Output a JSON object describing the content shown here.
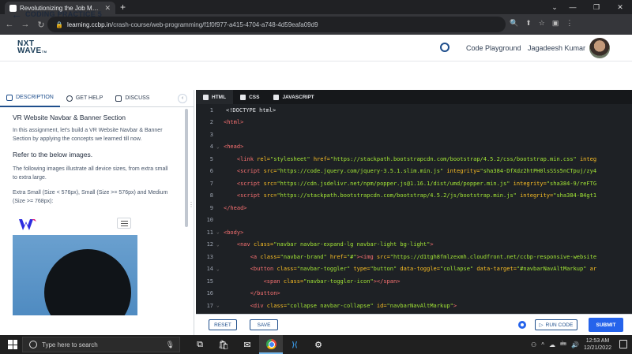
{
  "browser": {
    "tab_title": "Revolutionizing the Job Market |",
    "tab_close": "✕",
    "new_tab": "+",
    "url_host": "learning.ccbp.in",
    "url_path": "/crash-course/web-programming/f1f0f977-a415-4704-a748-4d59eafa09d9",
    "back": "←",
    "forward": "→",
    "reload": "↻",
    "lock": "🔒",
    "controls": [
      "⌄",
      "—",
      "❐",
      "✕"
    ],
    "addr_icons": [
      "🔍",
      "⬆",
      "☆",
      "▣",
      "⋮"
    ]
  },
  "header": {
    "logo_line1": "NXT",
    "logo_line2": "WAVE",
    "logo_tm": "TM",
    "code_playground": "Code Playground",
    "user_name": "Jagadeesh Kumar"
  },
  "subheader": {
    "back_icon": "←",
    "title": "CODING PRACTICE 5"
  },
  "left_panel": {
    "tabs": [
      {
        "label": "DESCRIPTION"
      },
      {
        "label": "GET HELP"
      },
      {
        "label": "DISCUSS"
      }
    ],
    "collapse_icon": "‹",
    "title": "VR Website Navbar & Banner Section",
    "intro": "In this assignment, let's build a VR Website Navbar & Banner Section by applying the concepts we learned till now.",
    "refer_heading": "Refer to the below images.",
    "images_text": "The following images illustrate all device sizes, from extra small to extra large.",
    "sizes_text": "Extra Small (Size < 576px), Small (Size >= 576px) and Medium (Size >= 768px):",
    "splitter": "⋮"
  },
  "editor": {
    "tabs": [
      {
        "label": "HTML"
      },
      {
        "label": "CSS"
      },
      {
        "label": "JAVASCRIPT"
      }
    ],
    "lines": [
      {
        "n": "1",
        "fold": "",
        "indent": "",
        "parts": [
          {
            "t": "<!DOCTYPE html>",
            "c": "txt"
          }
        ]
      },
      {
        "n": "2",
        "fold": "",
        "indent": "",
        "parts": [
          {
            "t": "<html>",
            "c": "tag"
          }
        ]
      },
      {
        "n": "3",
        "fold": "",
        "indent": "",
        "parts": []
      },
      {
        "n": "4",
        "fold": "⌄",
        "indent": "",
        "parts": [
          {
            "t": "<head>",
            "c": "tag"
          }
        ]
      },
      {
        "n": "5",
        "fold": "",
        "indent": "    ",
        "parts": [
          {
            "t": "<link ",
            "c": "tag"
          },
          {
            "t": "rel=",
            "c": "attr"
          },
          {
            "t": "\"stylesheet\" ",
            "c": "str"
          },
          {
            "t": "href=",
            "c": "attr"
          },
          {
            "t": "\"https://stackpath.bootstrapcdn.com/bootstrap/4.5.2/css/bootstrap.min.css\" ",
            "c": "str"
          },
          {
            "t": "integ",
            "c": "attr"
          }
        ]
      },
      {
        "n": "6",
        "fold": "",
        "indent": "    ",
        "parts": [
          {
            "t": "<script ",
            "c": "tag"
          },
          {
            "t": "src=",
            "c": "attr"
          },
          {
            "t": "\"https://code.jquery.com/jquery-3.5.1.slim.min.js\" ",
            "c": "str"
          },
          {
            "t": "integrity=",
            "c": "attr"
          },
          {
            "t": "\"sha384-DfXdz2htPH0lsSSs5nCTpuj/zy4",
            "c": "str"
          }
        ]
      },
      {
        "n": "7",
        "fold": "",
        "indent": "    ",
        "parts": [
          {
            "t": "<script ",
            "c": "tag"
          },
          {
            "t": "src=",
            "c": "attr"
          },
          {
            "t": "\"https://cdn.jsdelivr.net/npm/popper.js@1.16.1/dist/umd/popper.min.js\" ",
            "c": "str"
          },
          {
            "t": "integrity=",
            "c": "attr"
          },
          {
            "t": "\"sha384-9/reFTG",
            "c": "str"
          }
        ]
      },
      {
        "n": "8",
        "fold": "",
        "indent": "    ",
        "parts": [
          {
            "t": "<script ",
            "c": "tag"
          },
          {
            "t": "src=",
            "c": "attr"
          },
          {
            "t": "\"https://stackpath.bootstrapcdn.com/bootstrap/4.5.2/js/bootstrap.min.js\" ",
            "c": "str"
          },
          {
            "t": "integrity=",
            "c": "attr"
          },
          {
            "t": "\"sha384-B4gt1",
            "c": "str"
          }
        ]
      },
      {
        "n": "9",
        "fold": "",
        "indent": "",
        "parts": [
          {
            "t": "</head>",
            "c": "tag"
          }
        ]
      },
      {
        "n": "10",
        "fold": "",
        "indent": "",
        "parts": []
      },
      {
        "n": "11",
        "fold": "⌄",
        "indent": "",
        "parts": [
          {
            "t": "<body>",
            "c": "tag"
          }
        ]
      },
      {
        "n": "12",
        "fold": "⌄",
        "indent": "    ",
        "parts": [
          {
            "t": "<nav ",
            "c": "tag"
          },
          {
            "t": "class=",
            "c": "attr"
          },
          {
            "t": "\"navbar navbar-expand-lg navbar-light bg-light\"",
            "c": "str"
          },
          {
            "t": ">",
            "c": "tag"
          }
        ]
      },
      {
        "n": "13",
        "fold": "",
        "indent": "        ",
        "parts": [
          {
            "t": "<a ",
            "c": "tag"
          },
          {
            "t": "class=",
            "c": "attr"
          },
          {
            "t": "\"navbar-brand\" ",
            "c": "str"
          },
          {
            "t": "href=",
            "c": "attr"
          },
          {
            "t": "\"#\"",
            "c": "str"
          },
          {
            "t": "><img ",
            "c": "tag"
          },
          {
            "t": "src=",
            "c": "attr"
          },
          {
            "t": "\"https://d1tgh8fmlzexmh.cloudfront.net/ccbp-responsive-website",
            "c": "str"
          }
        ]
      },
      {
        "n": "14",
        "fold": "⌄",
        "indent": "        ",
        "parts": [
          {
            "t": "<button ",
            "c": "tag"
          },
          {
            "t": "class=",
            "c": "attr"
          },
          {
            "t": "\"navbar-toggler\" ",
            "c": "str"
          },
          {
            "t": "type=",
            "c": "attr"
          },
          {
            "t": "\"button\" ",
            "c": "str"
          },
          {
            "t": "data-toggle=",
            "c": "attr"
          },
          {
            "t": "\"collapse\" ",
            "c": "str"
          },
          {
            "t": "data-target=",
            "c": "attr"
          },
          {
            "t": "\"#navbarNavAltMarkup\" ",
            "c": "str"
          },
          {
            "t": "ar",
            "c": "attr"
          }
        ]
      },
      {
        "n": "15",
        "fold": "",
        "indent": "            ",
        "parts": [
          {
            "t": "<span ",
            "c": "tag"
          },
          {
            "t": "class=",
            "c": "attr"
          },
          {
            "t": "\"navbar-toggler-icon\"",
            "c": "str"
          },
          {
            "t": "></span>",
            "c": "tag"
          }
        ]
      },
      {
        "n": "16",
        "fold": "",
        "indent": "        ",
        "parts": [
          {
            "t": "</button>",
            "c": "tag"
          }
        ]
      },
      {
        "n": "17",
        "fold": "⌄",
        "indent": "        ",
        "parts": [
          {
            "t": "<div ",
            "c": "tag"
          },
          {
            "t": "class=",
            "c": "attr"
          },
          {
            "t": "\"collapse navbar-collapse\" ",
            "c": "str"
          },
          {
            "t": "id=",
            "c": "attr"
          },
          {
            "t": "\"navbarNavAltMarkup\"",
            "c": "str"
          },
          {
            "t": ">",
            "c": "tag"
          }
        ]
      }
    ]
  },
  "actions": {
    "reset": "RESET",
    "save": "SAVE",
    "run_code": "RUN CODE",
    "run_icon": "▷",
    "submit": "SUBMIT"
  },
  "taskbar": {
    "search_placeholder": "Type here to search",
    "mic": "🎙",
    "apps": [
      "⧉",
      "🛍",
      "✉",
      "chrome",
      "VS",
      "⚙"
    ],
    "tray": [
      "⚇",
      "^",
      "☁",
      "🖮",
      "🔊"
    ],
    "time": "12:53 AM",
    "date": "12/21/2022"
  },
  "colors": {
    "brand": "#1e4e8c",
    "editor_bg": "#1e2125",
    "submit_bg": "#2563eb"
  }
}
